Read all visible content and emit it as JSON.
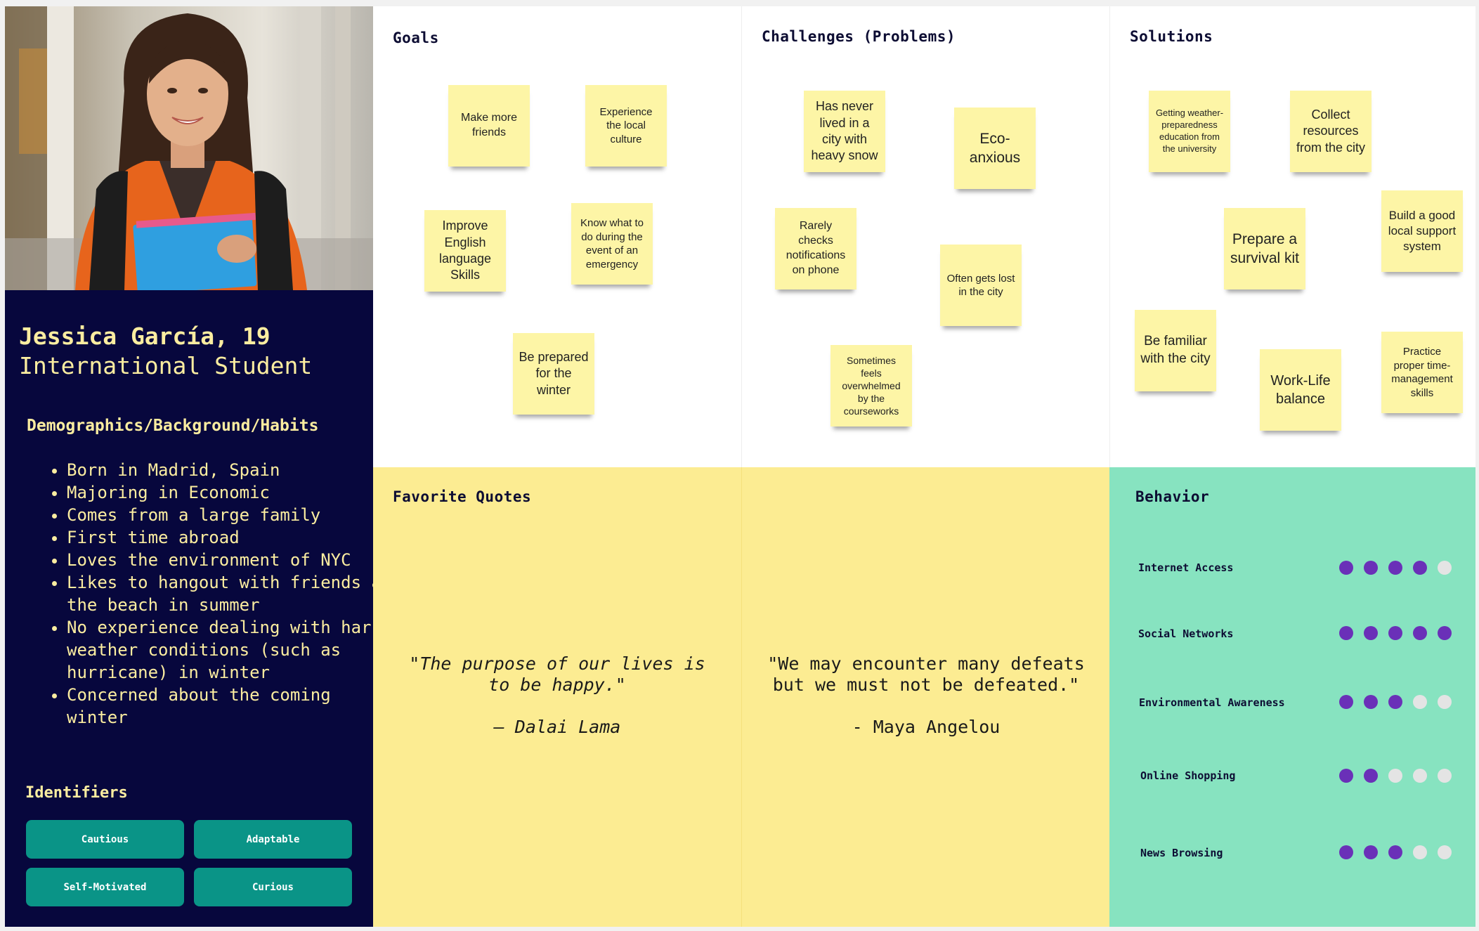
{
  "persona": {
    "name": "Jessica García, 19",
    "role": "International Student",
    "demographics_title": "Demographics/Background/Habits",
    "demographics": [
      "Born in Madrid, Spain",
      "Majoring in Economic",
      "Comes from a large family",
      "First time abroad",
      "Loves the environment of NYC",
      "Likes to hangout with friends at the beach in summer",
      "No experience dealing with harsh weather conditions (such as hurricane) in winter",
      "Concerned about the coming winter"
    ],
    "identifiers_title": "Identifiers",
    "identifiers": [
      "Cautious",
      "Adaptable",
      "Self-Motivated",
      "Curious"
    ]
  },
  "goals": {
    "title": "Goals",
    "notes": [
      "Make more friends",
      "Experience the local culture",
      "Improve English language Skills",
      "Know what to do during the event of an emergency",
      "Be prepared for the winter"
    ]
  },
  "challenges": {
    "title": "Challenges (Problems)",
    "notes": [
      "Has never lived in a city with heavy snow",
      "Eco-anxious",
      "Rarely checks notifications on phone",
      "Often gets lost in the city",
      "Sometimes feels overwhelmed by the courseworks"
    ]
  },
  "solutions": {
    "title": "Solutions",
    "notes": [
      "Getting weather-preparedness education from the university",
      "Collect resources from the city",
      "Prepare a survival kit",
      "Build a good local support system",
      "Be familiar with the city",
      "Work-Life balance",
      "Practice proper time-management skills"
    ]
  },
  "quotes": {
    "title": "Favorite Quotes",
    "q1_text": "\"The purpose of our lives is to be happy.\"",
    "q1_author": "— Dalai Lama",
    "q2_text": "\"We may encounter many defeats but we must not be defeated.\"",
    "q2_author": "- Maya Angelou"
  },
  "behavior": {
    "title": "Behavior",
    "max_rating": 5,
    "items": [
      {
        "label": "Internet Access",
        "rating": 4
      },
      {
        "label": "Social Networks",
        "rating": 5
      },
      {
        "label": "Environmental Awareness",
        "rating": 3
      },
      {
        "label": "Online Shopping",
        "rating": 2
      },
      {
        "label": "News Browsing",
        "rating": 3
      }
    ]
  },
  "colors": {
    "profile_bg": "#07073d",
    "profile_text": "#fbeda0",
    "sticky_note": "#fdf5a6",
    "quote_bg": "#fcec92",
    "behavior_bg": "#87e3c0",
    "identifier_button": "#0a9487",
    "dot_on": "#6a30b8",
    "dot_off": "#e4e4e4"
  }
}
